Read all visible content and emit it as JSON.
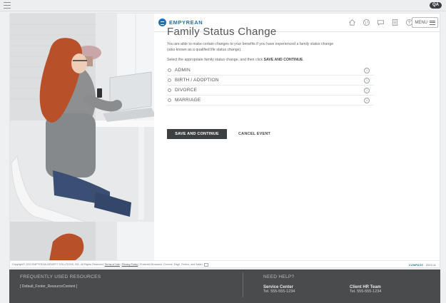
{
  "app": {
    "env_badge": "QA",
    "brand": "EMPYREAN",
    "menu_label": "MENU"
  },
  "header_icons": [
    "home-icon",
    "globe-icon",
    "chat-icon",
    "document-icon",
    "help-icon"
  ],
  "page": {
    "title": "Family Status Change",
    "intro": "You are able to make certain changes to your benefits if you have experienced a family status change (also known as a qualified life status change).",
    "instruction_prefix": "Select the appropriate family status change, and then click ",
    "instruction_bold": "SAVE AND CONTINUE",
    "instruction_suffix": ".",
    "options": [
      {
        "label": "ADMIN"
      },
      {
        "label": "BIRTH / ADOPTION"
      },
      {
        "label": "DIVORCE"
      },
      {
        "label": "MARRIAGE"
      }
    ],
    "save_button": "SAVE AND CONTINUE",
    "cancel_button": "CANCEL EVENT"
  },
  "infobar": {
    "copyright": "Copyright© 2023 EMPYREAN BENEFIT SOLUTIONS, INC. All Rights Reserved.",
    "terms": "Terms of Use",
    "privacy": "Privacy Policy",
    "browsers": "Preferred Browsers: Chrome, Edge, Firefox, and Safari",
    "compass": "COMPASS",
    "version": "2023.11"
  },
  "footer": {
    "resources_heading": "FREQUENTLY USED RESOURCES",
    "resources_content": "[ Default_Footer_ResourceContent ]",
    "help_heading": "NEED HELP?",
    "service_center_name": "Service Center",
    "service_center_tel": "Tel. 555-555-1234",
    "client_hr_name": "Client HR Team",
    "client_hr_tel": "Tel. 555-555-1234"
  }
}
